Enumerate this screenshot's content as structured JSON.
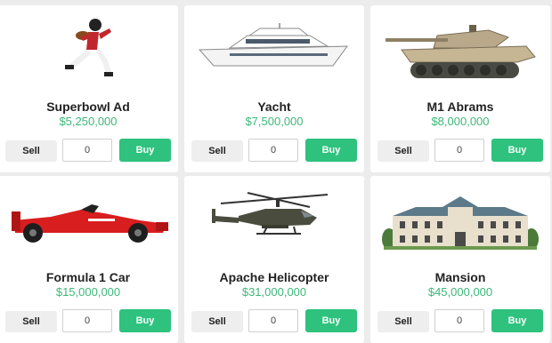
{
  "items": [
    {
      "name": "Superbowl Ad",
      "price": "$5,250,000",
      "icon": "football-player-icon",
      "sell_label": "Sell",
      "quantity": "0",
      "buy_label": "Buy"
    },
    {
      "name": "Yacht",
      "price": "$7,500,000",
      "icon": "yacht-icon",
      "sell_label": "Sell",
      "quantity": "0",
      "buy_label": "Buy"
    },
    {
      "name": "M1 Abrams",
      "price": "$8,000,000",
      "icon": "tank-icon",
      "sell_label": "Sell",
      "quantity": "0",
      "buy_label": "Buy"
    },
    {
      "name": "Formula 1 Car",
      "price": "$15,000,000",
      "icon": "race-car-icon",
      "sell_label": "Sell",
      "quantity": "0",
      "buy_label": "Buy"
    },
    {
      "name": "Apache Helicopter",
      "price": "$31,000,000",
      "icon": "helicopter-icon",
      "sell_label": "Sell",
      "quantity": "0",
      "buy_label": "Buy"
    },
    {
      "name": "Mansion",
      "price": "$45,000,000",
      "icon": "mansion-icon",
      "sell_label": "Sell",
      "quantity": "0",
      "buy_label": "Buy"
    }
  ],
  "colors": {
    "price": "#3cb878",
    "buy_button": "#2ec27e",
    "sell_button": "#eeeeee",
    "background": "#ececec"
  }
}
